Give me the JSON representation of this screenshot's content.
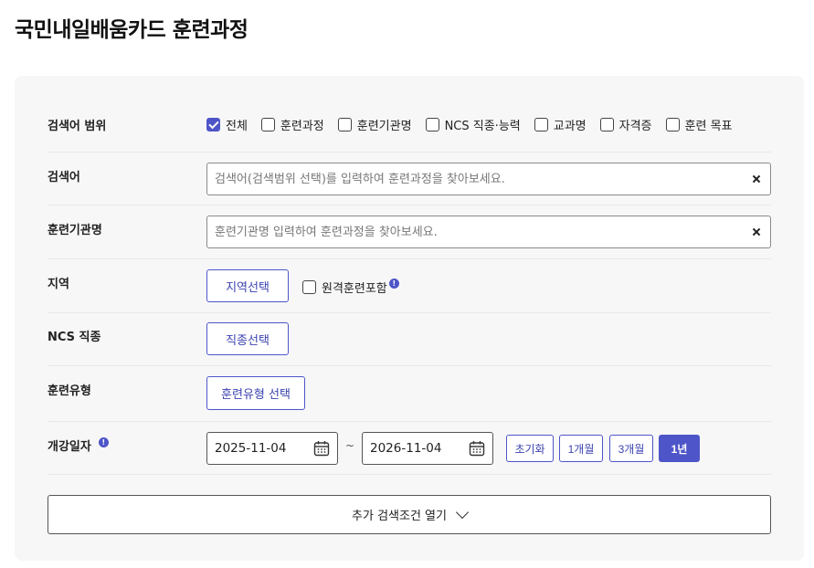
{
  "page": {
    "title": "국민내일배움카드 훈련과정"
  },
  "colors": {
    "accent": "#4e55c8",
    "panel_bg": "#f7f7f8"
  },
  "search_scope": {
    "label": "검색어 범위",
    "options": [
      {
        "label": "전체",
        "checked": true
      },
      {
        "label": "훈련과정",
        "checked": false
      },
      {
        "label": "훈련기관명",
        "checked": false
      },
      {
        "label": "NCS 직종·능력",
        "checked": false
      },
      {
        "label": "교과명",
        "checked": false
      },
      {
        "label": "자격증",
        "checked": false
      },
      {
        "label": "훈련 목표",
        "checked": false
      }
    ]
  },
  "keyword": {
    "label": "검색어",
    "value": "",
    "placeholder": "검색어(검색범위 선택)를 입력하여 훈련과정을 찾아보세요."
  },
  "institution": {
    "label": "훈련기관명",
    "value": "",
    "placeholder": "훈련기관명 입력하여 훈련과정을 찾아보세요."
  },
  "region": {
    "label": "지역",
    "button": "지역선택",
    "remote_label": "원격훈련포함",
    "remote_checked": false,
    "info_icon": "!"
  },
  "ncs": {
    "label": "NCS 직종",
    "button": "직종선택"
  },
  "training_type": {
    "label": "훈련유형",
    "button": "훈련유형 선택"
  },
  "open_date": {
    "label": "개강일자",
    "info_icon": "!",
    "start": "2025-11-04",
    "separator": "~",
    "end": "2026-11-04",
    "buttons": [
      {
        "label": "초기화",
        "active": false
      },
      {
        "label": "1개월",
        "active": false
      },
      {
        "label": "3개월",
        "active": false
      },
      {
        "label": "1년",
        "active": true
      }
    ]
  },
  "more_filters": {
    "label": "추가 검색조건 열기",
    "icon": "chevron-down-icon"
  }
}
